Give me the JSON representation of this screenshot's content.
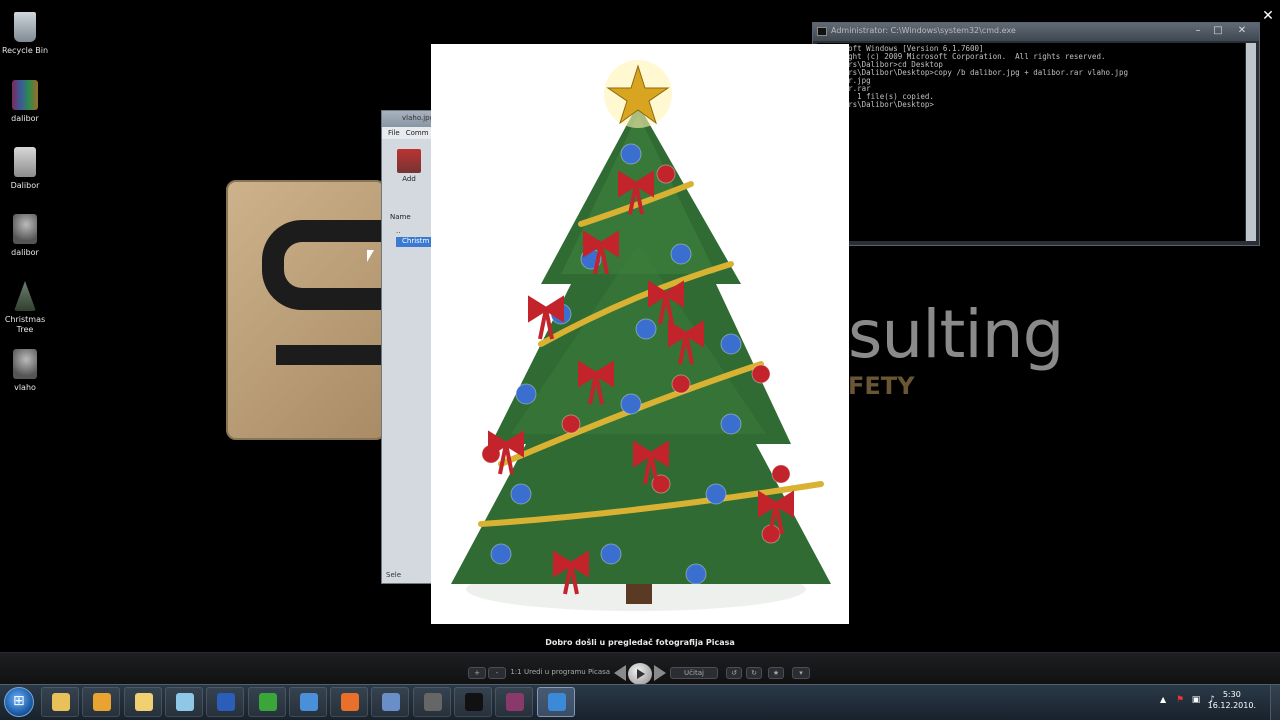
{
  "desktop": {
    "icons": [
      {
        "label": "Recycle Bin"
      },
      {
        "label": "dalibor"
      },
      {
        "label": "Dalibor"
      },
      {
        "label": "dalibor"
      },
      {
        "label": "Christmas Tree"
      },
      {
        "label": "vlaho"
      }
    ],
    "background": {
      "brand_text": "sulting",
      "brand_sub": "FETY"
    }
  },
  "explorer": {
    "title": "vlaho.jpg",
    "menu": [
      "File",
      "Comm"
    ],
    "add_label": "Add",
    "column_name": "Name",
    "parent_item": "..",
    "file_item": "Christm",
    "status": "Sele"
  },
  "cmd": {
    "title": "Administrator: C:\\Windows\\system32\\cmd.exe",
    "lines": [
      "Microsoft Windows [Version 6.1.7600]",
      "Copyright (c) 2009 Microsoft Corporation.  All rights reserved.",
      "",
      "C:\\Users\\Dalibor>cd Desktop",
      "",
      "C:\\Users\\Dalibor\\Desktop>copy /b dalibor.jpg + dalibor.rar vlaho.jpg",
      "dalibor.jpg",
      "dalibor.rar",
      "        1 file(s) copied.",
      "",
      "C:\\Users\\Dalibor\\Desktop>"
    ]
  },
  "viewer": {
    "caption": "Dobro došli u pregledač fotografija Picasa",
    "toolbar": {
      "zoom_in": "+",
      "zoom_out": "-",
      "actual_size": "1:1",
      "edit_label": "Uredi u programu Picasa",
      "load_label": "Učitaj",
      "rotate_left": "↺",
      "rotate_right": "↻",
      "star": "★",
      "more": "▾"
    }
  },
  "taskbar": {
    "clock_time": "5:30",
    "clock_date": "16.12.2010.",
    "apps": [
      {
        "name": "explorer",
        "color": "#e8c15a"
      },
      {
        "name": "outlook",
        "color": "#e8a330"
      },
      {
        "name": "folder",
        "color": "#f0d070"
      },
      {
        "name": "notepad",
        "color": "#8fc7e8"
      },
      {
        "name": "word",
        "color": "#2b5eb8"
      },
      {
        "name": "utorrent",
        "color": "#3aa63a"
      },
      {
        "name": "itunes",
        "color": "#4a90d8"
      },
      {
        "name": "firefox",
        "color": "#e8702a"
      },
      {
        "name": "network",
        "color": "#6a8fc8"
      },
      {
        "name": "tool",
        "color": "#666666"
      },
      {
        "name": "cmd",
        "color": "#111111"
      },
      {
        "name": "winrar",
        "color": "#8a3a6a"
      },
      {
        "name": "picasa",
        "color": "#3a8ad8"
      }
    ]
  },
  "colors": {
    "tree_green": "#2f6b32",
    "ornament_red": "#c3232a",
    "ornament_blue": "#3a6fd0",
    "garland_gold": "#d9b233"
  }
}
